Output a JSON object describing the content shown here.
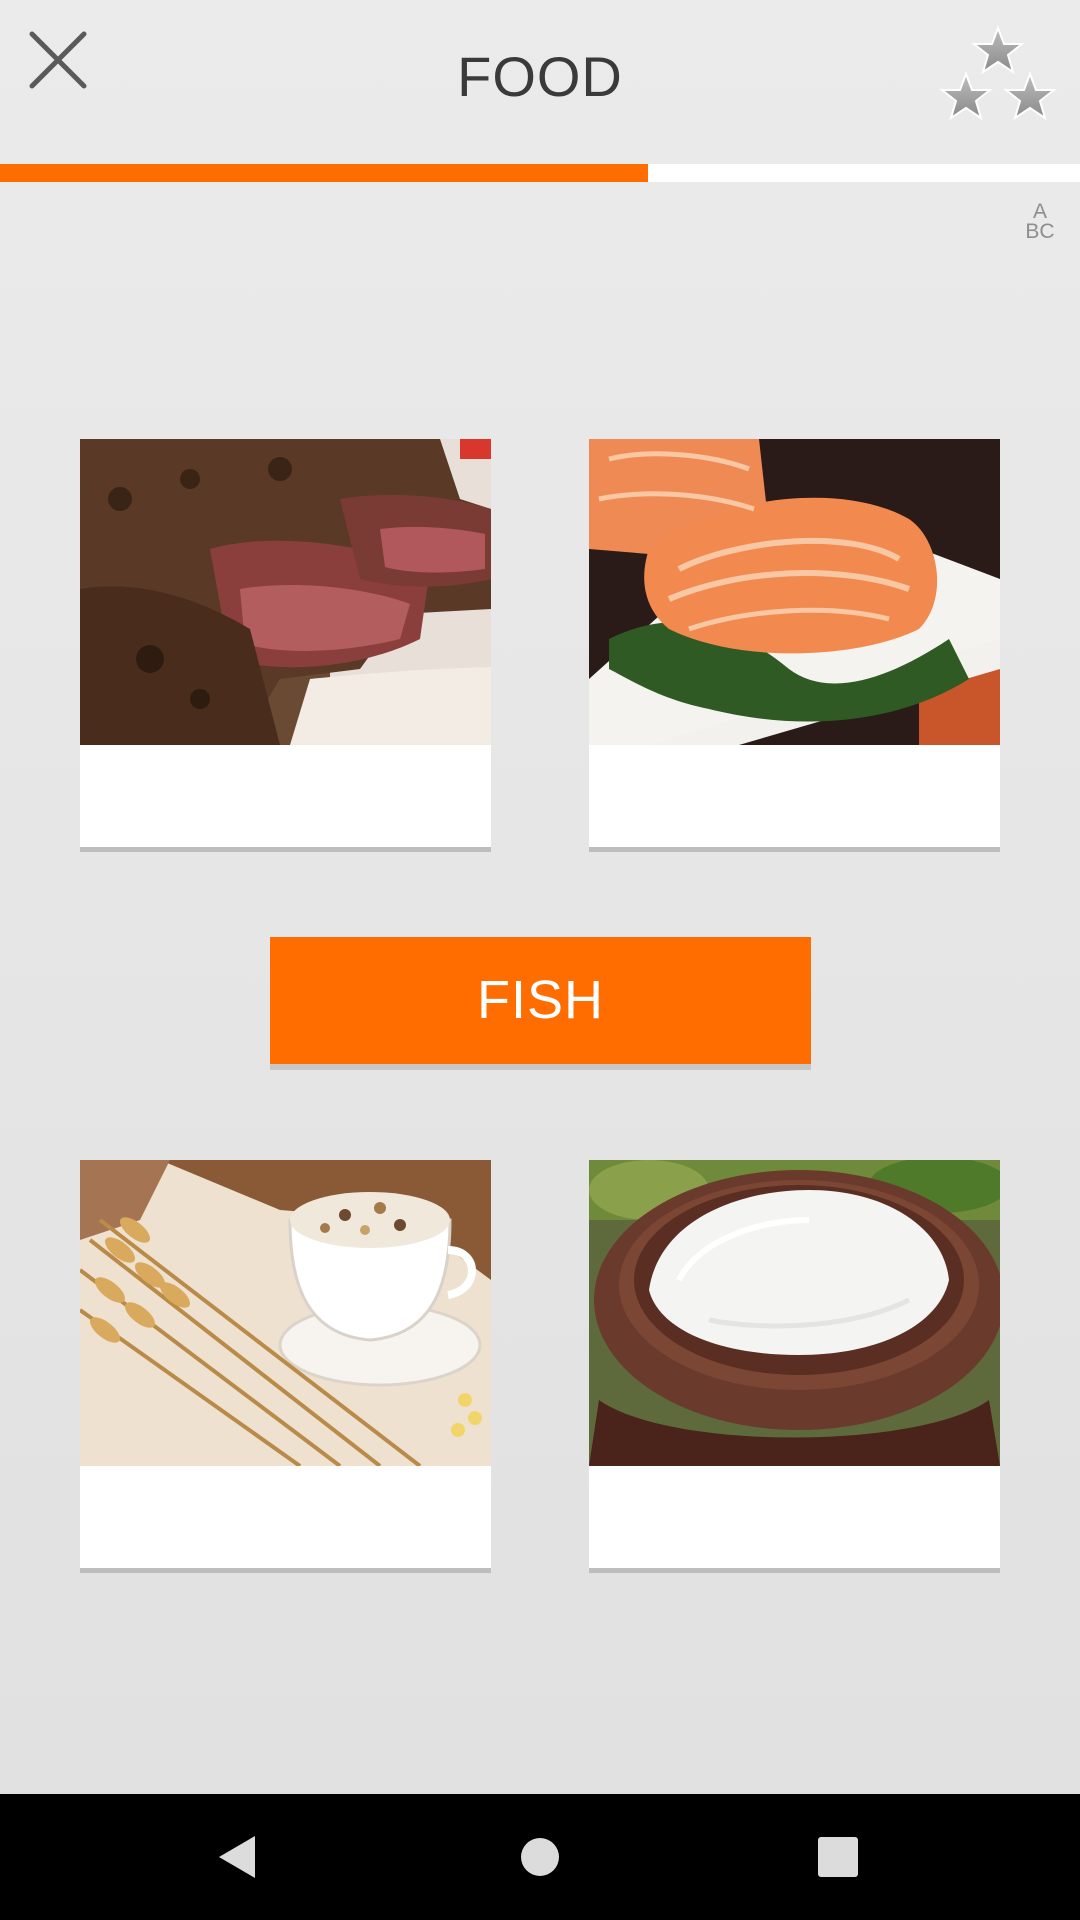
{
  "header": {
    "title": "FOOD",
    "close_icon": "close-icon",
    "stars_icon": "stars-icon"
  },
  "progress": {
    "fraction": 0.6
  },
  "abc_button": {
    "line1": "A",
    "line2": "BC"
  },
  "cards": [
    {
      "image": "grilled-steak-image",
      "label": ""
    },
    {
      "image": "salmon-fillet-image",
      "label": ""
    },
    {
      "image": "wheat-and-cereal-image",
      "label": ""
    },
    {
      "image": "rice-bowl-image",
      "label": ""
    }
  ],
  "prompt_word": "FISH",
  "colors": {
    "accent": "#ff6d00",
    "background": "#e6e6e6",
    "card": "#ffffff",
    "navbar": "#000000"
  },
  "navbar": {
    "back_icon": "back-triangle-icon",
    "home_icon": "home-circle-icon",
    "recents_icon": "recents-square-icon"
  }
}
